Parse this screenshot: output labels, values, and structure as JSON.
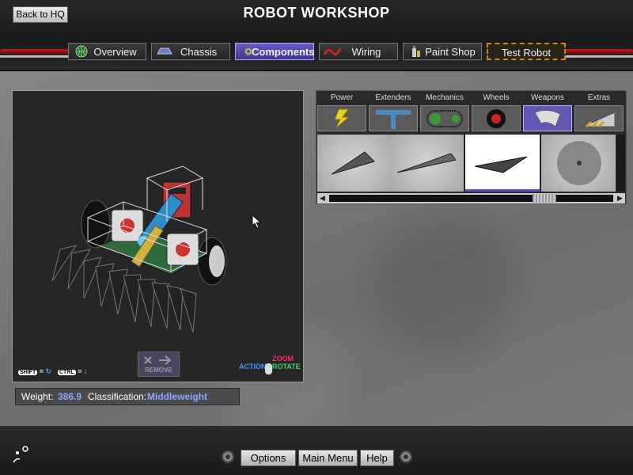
{
  "header": {
    "back_label": "Back to HQ",
    "title": "ROBOT WORKSHOP"
  },
  "tabs": [
    {
      "label": "Overview",
      "icon": "globe-icon"
    },
    {
      "label": "Chassis",
      "icon": "chassis-icon"
    },
    {
      "label": "Components",
      "icon": "gear-icon",
      "active": true
    },
    {
      "label": "Wiring",
      "icon": "wire-icon"
    },
    {
      "label": "Paint Shop",
      "icon": "spray-paint-icon"
    },
    {
      "label": "Test Robot",
      "icon": "hazard-stripes"
    }
  ],
  "viewport": {
    "remove_label": "REMOVE",
    "shift_key": "SHIFT",
    "ctrl_key": "CTRL",
    "equals": "=",
    "action_label": "ACTION-",
    "zoom_label": "ZOOM",
    "rotate_label": "ROTATE"
  },
  "stats": {
    "weight_label": "Weight:",
    "weight_value": "386.9",
    "class_label": "Classification:",
    "class_value": "Middleweight"
  },
  "categories": [
    {
      "label": "Power",
      "icon": "lightning-icon"
    },
    {
      "label": "Extenders",
      "icon": "extender-icon"
    },
    {
      "label": "Mechanics",
      "icon": "chain-belt-icon"
    },
    {
      "label": "Wheels",
      "icon": "wheel-icon"
    },
    {
      "label": "Weapons",
      "icon": "blade-icon",
      "active": true
    },
    {
      "label": "Extras",
      "icon": "wedge-icon"
    }
  ],
  "component_thumbs": [
    "spike-cone",
    "long-spike",
    "blade",
    "disc"
  ],
  "bottom": {
    "options_label": "Options",
    "main_menu_label": "Main Menu",
    "help_label": "Help"
  },
  "colors": {
    "accent": "#5a50c0",
    "value_text": "#8fa6ff",
    "cable_red": "#c82020"
  }
}
